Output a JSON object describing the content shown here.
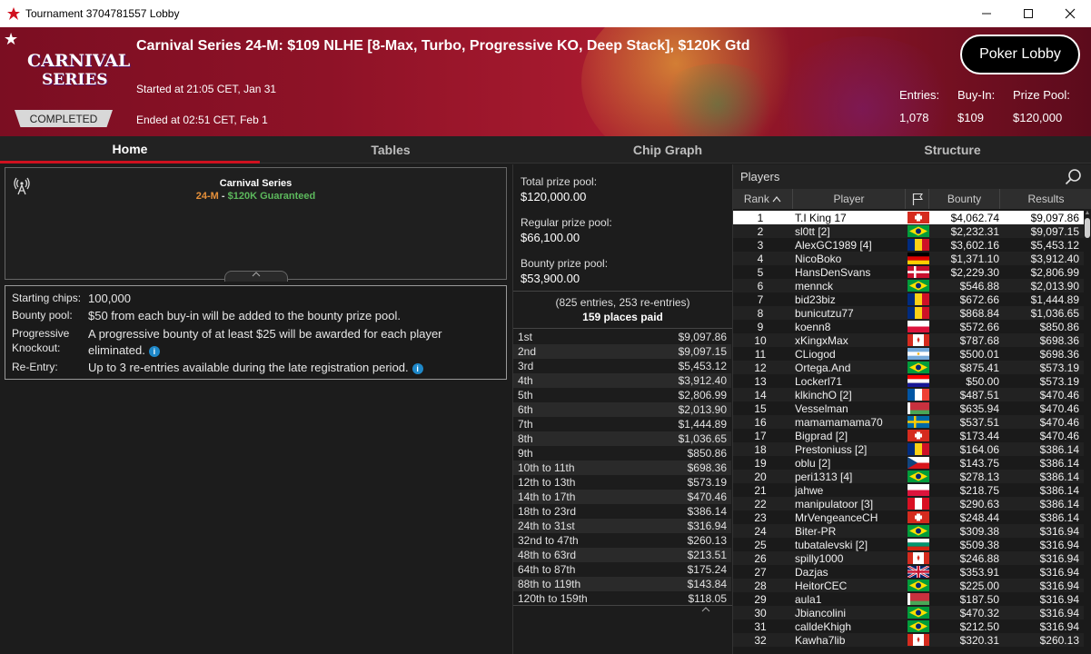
{
  "window": {
    "title": "Tournament 3704781557 Lobby",
    "controls": [
      "minimize",
      "maximize",
      "close"
    ]
  },
  "header": {
    "logo_line1": "CARNIVAL",
    "logo_line2": "SERIES",
    "status_badge": "COMPLETED",
    "tournament_name": "Carnival Series 24-M: $109 NLHE [8-Max, Turbo, Progressive KO, Deep Stack], $120K Gtd",
    "started": "Started at 21:05 CET, Jan 31",
    "ended": "Ended at 02:51 CET, Feb 1",
    "poker_lobby_button": "Poker Lobby",
    "entries_label": "Entries:",
    "entries_value": "1,078",
    "buyin_label": "Buy-In:",
    "buyin_value": "$109",
    "prizepool_label": "Prize Pool:",
    "prizepool_value": "$120,000"
  },
  "tabs": [
    "Home",
    "Tables",
    "Chip Graph",
    "Structure"
  ],
  "info": {
    "series": "Carnival Series",
    "event": "24-M",
    "separator": " - ",
    "guarantee": "$120K Guaranteed"
  },
  "details": {
    "starting_chips_label": "Starting chips:",
    "starting_chips_value": "100,000",
    "bounty_pool_label": "Bounty pool:",
    "bounty_pool_value": "$50 from each buy-in will be added to the bounty prize pool.",
    "pko_label_1": "Progressive",
    "pko_label_2": "Knockout:",
    "pko_value_1": "A progressive bounty of at least $25 will be awarded for each player",
    "pko_value_2": "eliminated.",
    "reentry_label": "Re-Entry:",
    "reentry_value": "Up to 3 re-entries available during the late registration period."
  },
  "prizes": {
    "total_label": "Total prize pool:",
    "total_value": "$120,000.00",
    "regular_label": "Regular prize pool:",
    "regular_value": "$66,100.00",
    "bounty_label": "Bounty prize pool:",
    "bounty_value": "$53,900.00",
    "entries_text": "(825 entries, 253 re-entries)",
    "places_text": "159 places paid",
    "payouts": [
      [
        "1st",
        "$9,097.86"
      ],
      [
        "2nd",
        "$9,097.15"
      ],
      [
        "3rd",
        "$5,453.12"
      ],
      [
        "4th",
        "$3,912.40"
      ],
      [
        "5th",
        "$2,806.99"
      ],
      [
        "6th",
        "$2,013.90"
      ],
      [
        "7th",
        "$1,444.89"
      ],
      [
        "8th",
        "$1,036.65"
      ],
      [
        "9th",
        "$850.86"
      ],
      [
        "10th to 11th",
        "$698.36"
      ],
      [
        "12th to 13th",
        "$573.19"
      ],
      [
        "14th to 17th",
        "$470.46"
      ],
      [
        "18th to 23rd",
        "$386.14"
      ],
      [
        "24th to 31st",
        "$316.94"
      ],
      [
        "32nd to 47th",
        "$260.13"
      ],
      [
        "48th to 63rd",
        "$213.51"
      ],
      [
        "64th to 87th",
        "$175.24"
      ],
      [
        "88th to 119th",
        "$143.84"
      ],
      [
        "120th to 159th",
        "$118.05"
      ]
    ]
  },
  "players": {
    "label": "Players",
    "columns": [
      "Rank",
      "Player",
      "Bounty",
      "Results"
    ],
    "rows": [
      {
        "rank": "1",
        "name": "T.I King 17",
        "flag": "ch",
        "bounty": "$4,062.74",
        "result": "$9,097.86"
      },
      {
        "rank": "2",
        "name": "sl0tt [2]",
        "flag": "br",
        "bounty": "$2,232.31",
        "result": "$9,097.15"
      },
      {
        "rank": "3",
        "name": "AlexGC1989 [4]",
        "flag": "ro",
        "bounty": "$3,602.16",
        "result": "$5,453.12"
      },
      {
        "rank": "4",
        "name": "NicoBoko",
        "flag": "de",
        "bounty": "$1,371.10",
        "result": "$3,912.40"
      },
      {
        "rank": "5",
        "name": "HansDenSvans",
        "flag": "dk",
        "bounty": "$2,229.30",
        "result": "$2,806.99"
      },
      {
        "rank": "6",
        "name": "mennck",
        "flag": "br",
        "bounty": "$546.88",
        "result": "$2,013.90"
      },
      {
        "rank": "7",
        "name": "bid23biz",
        "flag": "ro",
        "bounty": "$672.66",
        "result": "$1,444.89"
      },
      {
        "rank": "8",
        "name": "bunicutzu77",
        "flag": "ro",
        "bounty": "$868.84",
        "result": "$1,036.65"
      },
      {
        "rank": "9",
        "name": "koenn8",
        "flag": "pl",
        "bounty": "$572.66",
        "result": "$850.86"
      },
      {
        "rank": "10",
        "name": "xKingxMax",
        "flag": "ca",
        "bounty": "$787.68",
        "result": "$698.36"
      },
      {
        "rank": "11",
        "name": "CLiogod",
        "flag": "ar",
        "bounty": "$500.01",
        "result": "$698.36"
      },
      {
        "rank": "12",
        "name": "Ortega.And",
        "flag": "br",
        "bounty": "$875.41",
        "result": "$573.19"
      },
      {
        "rank": "13",
        "name": "Lockerl71",
        "flag": "hr",
        "bounty": "$50.00",
        "result": "$573.19"
      },
      {
        "rank": "14",
        "name": "klkinchO [2]",
        "flag": "fr",
        "bounty": "$487.51",
        "result": "$470.46"
      },
      {
        "rank": "15",
        "name": "Vesselman",
        "flag": "by",
        "bounty": "$635.94",
        "result": "$470.46"
      },
      {
        "rank": "16",
        "name": "mamamamama70",
        "flag": "se",
        "bounty": "$537.51",
        "result": "$470.46"
      },
      {
        "rank": "17",
        "name": "Bigprad [2]",
        "flag": "ch",
        "bounty": "$173.44",
        "result": "$470.46"
      },
      {
        "rank": "18",
        "name": "Prestoniuss [2]",
        "flag": "ro",
        "bounty": "$164.06",
        "result": "$386.14"
      },
      {
        "rank": "19",
        "name": "oblu [2]",
        "flag": "cz",
        "bounty": "$143.75",
        "result": "$386.14"
      },
      {
        "rank": "20",
        "name": "peri1313 [4]",
        "flag": "br",
        "bounty": "$278.13",
        "result": "$386.14"
      },
      {
        "rank": "21",
        "name": "jahwe",
        "flag": "pl",
        "bounty": "$218.75",
        "result": "$386.14"
      },
      {
        "rank": "22",
        "name": "manipulatoor [3]",
        "flag": "pe",
        "bounty": "$290.63",
        "result": "$386.14"
      },
      {
        "rank": "23",
        "name": "MrVengeanceCH",
        "flag": "ch",
        "bounty": "$248.44",
        "result": "$386.14"
      },
      {
        "rank": "24",
        "name": "Biter-PR",
        "flag": "br",
        "bounty": "$309.38",
        "result": "$316.94"
      },
      {
        "rank": "25",
        "name": "tubatalevski [2]",
        "flag": "bg",
        "bounty": "$509.38",
        "result": "$316.94"
      },
      {
        "rank": "26",
        "name": "spilly1000",
        "flag": "ca",
        "bounty": "$246.88",
        "result": "$316.94"
      },
      {
        "rank": "27",
        "name": "Dazjas",
        "flag": "gb",
        "bounty": "$353.91",
        "result": "$316.94"
      },
      {
        "rank": "28",
        "name": "HeitorCEC",
        "flag": "br",
        "bounty": "$225.00",
        "result": "$316.94"
      },
      {
        "rank": "29",
        "name": "aula1",
        "flag": "by",
        "bounty": "$187.50",
        "result": "$316.94"
      },
      {
        "rank": "30",
        "name": "Jbiancolini",
        "flag": "br",
        "bounty": "$470.32",
        "result": "$316.94"
      },
      {
        "rank": "31",
        "name": "calldeKhigh",
        "flag": "br",
        "bounty": "$212.50",
        "result": "$316.94"
      },
      {
        "rank": "32",
        "name": "Kawha7lib",
        "flag": "ca",
        "bounty": "$320.31",
        "result": "$260.13"
      }
    ]
  },
  "colors": {
    "accent_red": "#d0111f",
    "guarantee_green": "#5cb85c",
    "event_orange": "#e6903a",
    "info_blue": "#1e88c9"
  }
}
